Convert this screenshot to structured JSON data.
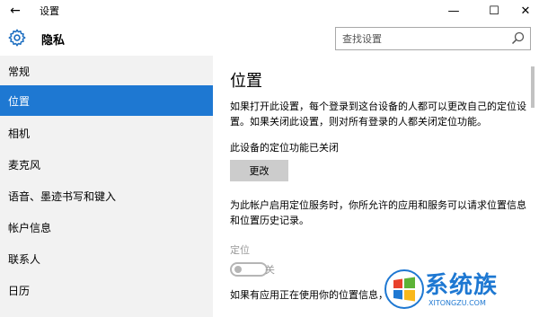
{
  "window": {
    "title": "设置",
    "controls": {
      "minimize": "—",
      "maximize": "☐",
      "close": "✕"
    }
  },
  "header": {
    "section_title": "隐私",
    "section_icon": "gear-icon",
    "search": {
      "placeholder": "查找设置",
      "icon": "search-icon"
    }
  },
  "sidebar": {
    "items": [
      {
        "label": "常规",
        "active": false
      },
      {
        "label": "位置",
        "active": true
      },
      {
        "label": "相机",
        "active": false
      },
      {
        "label": "麦克风",
        "active": false
      },
      {
        "label": "语音、墨迹书写和键入",
        "active": false
      },
      {
        "label": "帐户信息",
        "active": false
      },
      {
        "label": "联系人",
        "active": false
      },
      {
        "label": "日历",
        "active": false
      }
    ]
  },
  "main": {
    "title": "位置",
    "description_1": "如果打开此设置，每个登录到这台设备的人都可以更改自己的定位设置。如果关闭此设置，则对所有登录的人都关闭定位功能。",
    "device_status": "此设备的定位功能已关闭",
    "change_button": "更改",
    "description_2": "为此帐户启用定位服务时，你所允许的应用和服务可以请求位置信息和位置历史记录。",
    "location_label": "定位",
    "toggle_state": "关",
    "description_3": "如果有应用正在使用你的位置信息，"
  },
  "watermark": {
    "text": "系统族",
    "url": "XITONGZU.COM"
  },
  "colors": {
    "accent": "#1e78d2",
    "sidebar_bg": "#f2f2f2",
    "button_bg": "#cccccc"
  }
}
